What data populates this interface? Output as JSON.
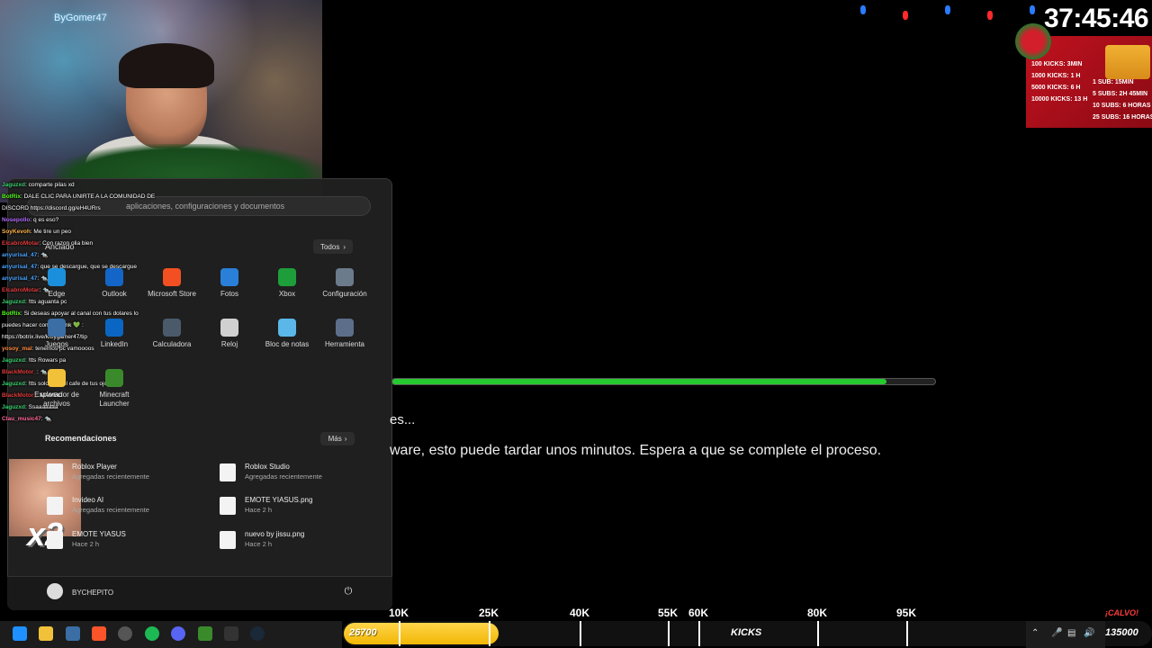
{
  "webcam": {
    "brand": "ByGomer47"
  },
  "start_menu": {
    "search_placeholder": "aplicaciones, configuraciones y documentos",
    "pinned_title": "Anclado",
    "all_apps_label": "Todos",
    "pinned": [
      {
        "name": "Edge",
        "icon": "edge-icon",
        "color": "#1b8fdb"
      },
      {
        "name": "Outlook",
        "icon": "outlook-icon",
        "color": "#1366c7"
      },
      {
        "name": "Microsoft Store",
        "icon": "store-icon",
        "color": "#f25022"
      },
      {
        "name": "Fotos",
        "icon": "photos-icon",
        "color": "#2a7fd8"
      },
      {
        "name": "Xbox",
        "icon": "xbox-icon",
        "color": "#1e9e3a"
      },
      {
        "name": "Configuración",
        "icon": "gear-icon",
        "color": "#6b7b8c"
      },
      {
        "name": "Juegos",
        "icon": "games-icon",
        "color": "#3a6ea5"
      },
      {
        "name": "LinkedIn",
        "icon": "linkedin-icon",
        "color": "#0a66c2"
      },
      {
        "name": "Calculadora",
        "icon": "calculator-icon",
        "color": "#4a5a6a"
      },
      {
        "name": "Reloj",
        "icon": "clock-icon",
        "color": "#d0d0d0"
      },
      {
        "name": "Bloc de notas",
        "icon": "notepad-icon",
        "color": "#5ab7e8"
      },
      {
        "name": "Herramienta",
        "icon": "tool-icon",
        "color": "#5d6e8a"
      },
      {
        "name": "Explorador de archivos",
        "icon": "folder-icon",
        "color": "#f2c13a"
      },
      {
        "name": "Minecraft Launcher",
        "icon": "minecraft-icon",
        "color": "#3a8a2b"
      }
    ],
    "recommendations_title": "Recomendaciones",
    "more_label": "Más",
    "recommended": [
      {
        "name": "Roblox Player",
        "sub": "Agregadas recientemente"
      },
      {
        "name": "Roblox Studio",
        "sub": "Agregadas recientemente"
      },
      {
        "name": "Invideo AI",
        "sub": "Agregadas recientemente"
      },
      {
        "name": "EMOTE YIASUS.png",
        "sub": "Hace 2 h"
      },
      {
        "name": "EMOTE YIASUS",
        "sub": "Hace 2 h"
      },
      {
        "name": "nuevo by jissu.png",
        "sub": "Hace 2 h"
      }
    ],
    "user_name": "BYCHEPITO"
  },
  "chat": [
    {
      "user": "Jaguzxd",
      "text": ": comparte pilas xd",
      "color": "#3bd16f"
    },
    {
      "user": "BotRix",
      "text": ": DALE CLIC PARA UNIRTE A LA COMUNIDAD DE",
      "color": "#53fc18"
    },
    {
      "user": "",
      "text": "DISCORD https://discord.gg/eH4URrs",
      "color": "#ffffff"
    },
    {
      "user": "Nosepollo",
      "text": ": q es eso?",
      "color": "#b36cff"
    },
    {
      "user": "SoyKevoh",
      "text": ": Me tire un peo",
      "color": "#ffb347"
    },
    {
      "user": "ElcabroMotar",
      "text": ": Con razon olia bien",
      "color": "#e23b3b"
    },
    {
      "user": "anyurisal_47",
      "text": ": 🐀",
      "color": "#4aa3ff"
    },
    {
      "user": "anyurisal_47",
      "text": ": que se descargue, que se descargue",
      "color": "#4aa3ff"
    },
    {
      "user": "anyurisal_47",
      "text": ": 🐀",
      "color": "#4aa3ff"
    },
    {
      "user": "ElcabroMotar",
      "text": ": 🐀",
      "color": "#e23b3b"
    },
    {
      "user": "Jaguzxd",
      "text": ": !tts aguanta pc",
      "color": "#3bd16f"
    },
    {
      "user": "BotRix",
      "text": ": Si deseas apoyar al canal con tus dolares lo",
      "color": "#53fc18"
    },
    {
      "user": "",
      "text": "puedes hacer con este link 💚 :",
      "color": "#ffffff"
    },
    {
      "user": "",
      "text": "https://botrix.live/k/bygamer47/tip",
      "color": "#ffffff"
    },
    {
      "user": "yosoy_mal",
      "text": ": tenemos pc vamoooos",
      "color": "#ff8c42"
    },
    {
      "user": "Jaguzxd",
      "text": ": !tts Rowars pa",
      "color": "#3bd16f"
    },
    {
      "user": "BlackMotor_",
      "text": ": 🐀",
      "color": "#e23b3b"
    },
    {
      "user": "Jaguzxd",
      "text": ": !tts solo esta el cafe de tus ojos",
      "color": "#3bd16f"
    },
    {
      "user": "BlackMotor_",
      "text": ": MAMBO",
      "color": "#e23b3b"
    },
    {
      "user": "Jaguzxd",
      "text": ": Ssaaaaaaa",
      "color": "#3bd16f"
    },
    {
      "user": "Clau_music47",
      "text": ": 🐀",
      "color": "#ff6b9a"
    }
  ],
  "overlay": {
    "x2": "x2",
    "timer": "37:45:46",
    "kick_rates": [
      "100 KICKS: 3MIN",
      "1000 KICKS: 1 H",
      "5000 KICKS: 6 H",
      "10000 KICKS: 13 H"
    ],
    "sub_rates": [
      "1 SUB: 15MIN",
      "5 SUBS: 2H 45MIN",
      "10 SUBS: 6 HORAS",
      "25 SUBS: 16 HORAS"
    ],
    "light_colors": [
      "#2a7bff",
      "#ff2a2a",
      "#2a7bff",
      "#ff2a2a",
      "#2a7bff"
    ]
  },
  "installer": {
    "progress": 0.91,
    "line1": "es...",
    "line2": "ware, esto puede tardar unos minutos. Espera a que se complete el proceso."
  },
  "goal_bar": {
    "current": "26700",
    "marks": [
      "10K",
      "25K",
      "40K",
      "55K",
      "60K",
      "80K",
      "95K"
    ],
    "label": "KICKS",
    "end_value": "135000",
    "callout": "¡CALVO!"
  }
}
